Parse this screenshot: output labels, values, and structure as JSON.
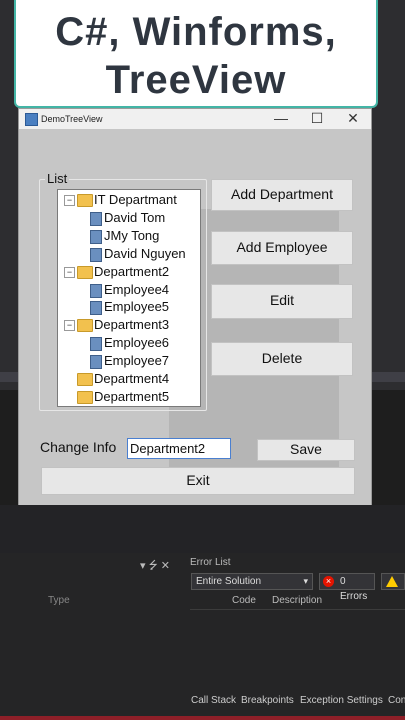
{
  "banner": {
    "line1": "C#, Winforms,",
    "line2": "TreeView"
  },
  "window": {
    "title": "DemoTreeView",
    "controls": {
      "minimize": "—",
      "maximize": "☐",
      "close": "✕"
    }
  },
  "group": {
    "label": "List"
  },
  "tree": [
    {
      "label": "IT Departmant",
      "level": 0,
      "expanded": true
    },
    {
      "label": "David Tom",
      "level": 1
    },
    {
      "label": "JMy Tong",
      "level": 1
    },
    {
      "label": "David Nguyen",
      "level": 1
    },
    {
      "label": "Department2",
      "level": 0,
      "expanded": true
    },
    {
      "label": "Employee4",
      "level": 1
    },
    {
      "label": "Employee5",
      "level": 1
    },
    {
      "label": "Department3",
      "level": 0,
      "expanded": true
    },
    {
      "label": "Employee6",
      "level": 1
    },
    {
      "label": "Employee7",
      "level": 1
    },
    {
      "label": "Department4",
      "level": 0
    },
    {
      "label": "Department5",
      "level": 0
    }
  ],
  "buttons": {
    "add_department": "Add Department",
    "add_employee": "Add Employee",
    "edit": "Edit",
    "delete": "Delete",
    "save": "Save",
    "exit": "Exit"
  },
  "change_info": {
    "label": "Change Info",
    "value": "Department2"
  },
  "ide": {
    "left_pane": {
      "header_icons": "▾ ⭍ ✕",
      "type_label": "Type"
    },
    "error_list": {
      "title": "Error List",
      "scope": "Entire Solution",
      "errors": "0 Errors",
      "columns": [
        "Code",
        "Description"
      ]
    },
    "tabs": [
      "Call Stack",
      "Breakpoints",
      "Exception Settings",
      "Con"
    ]
  },
  "colors": {
    "banner_border": "#43b5a6",
    "status_bar": "#8e1f28"
  }
}
